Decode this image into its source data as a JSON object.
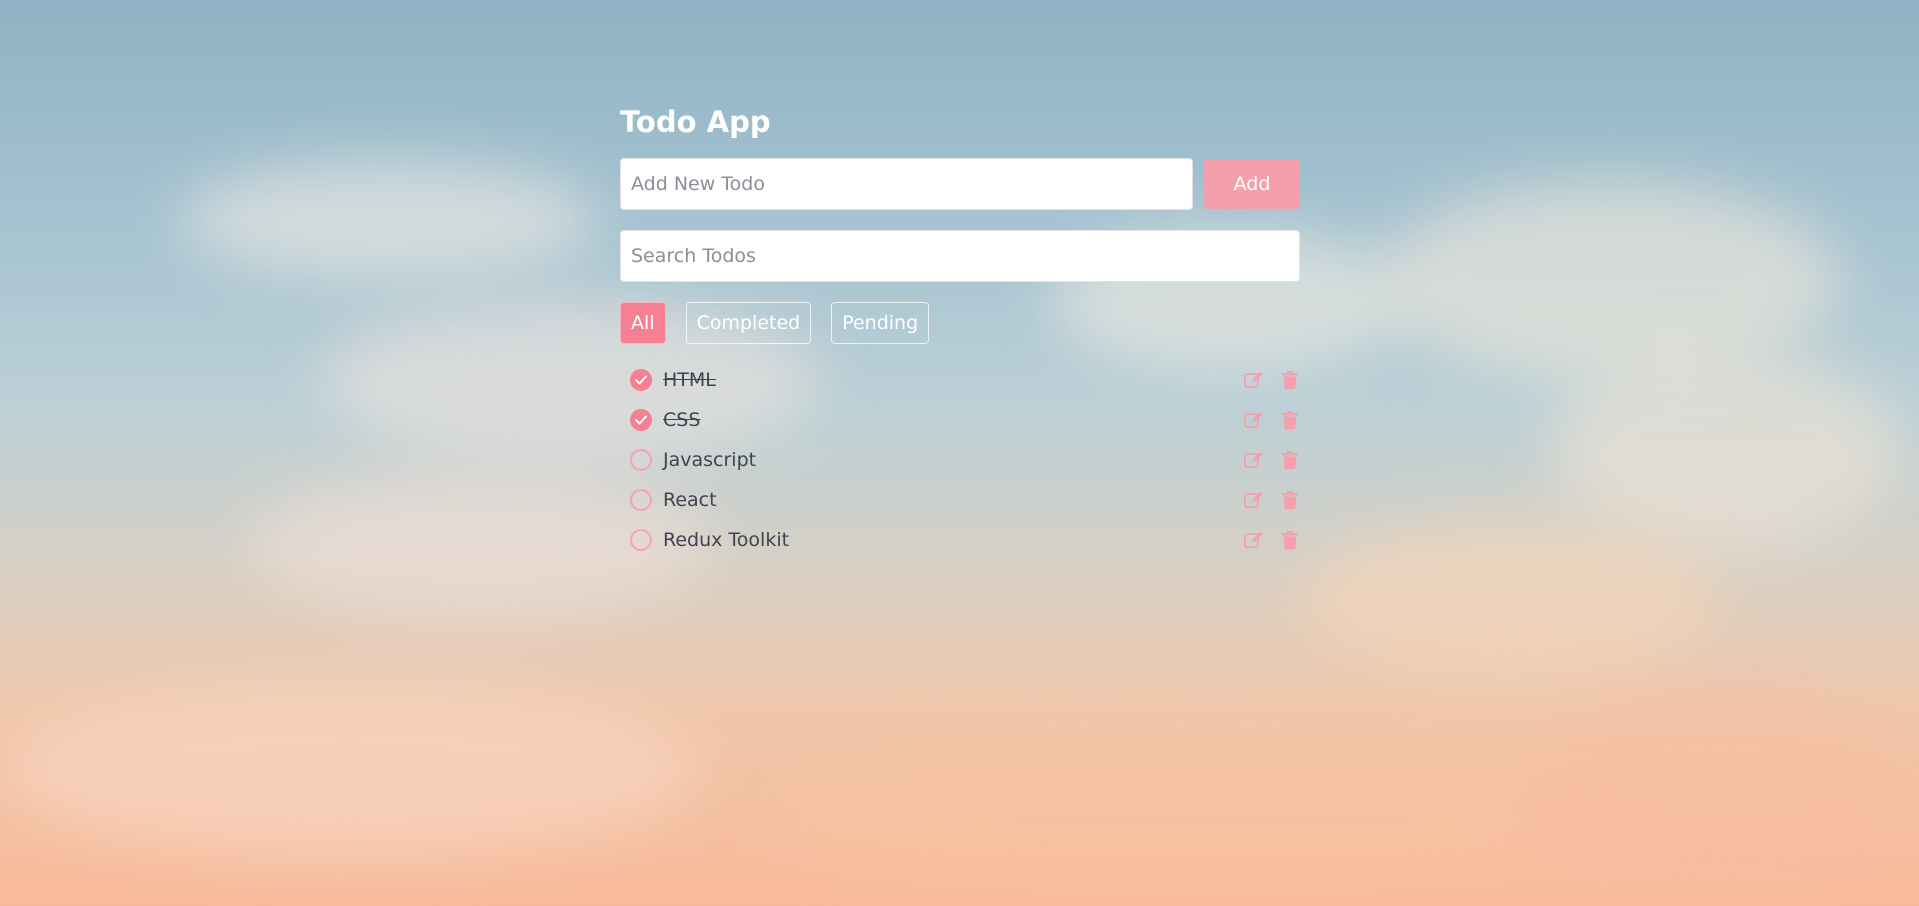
{
  "app": {
    "title": "Todo App",
    "add_placeholder": "Add New Todo",
    "add_label": "Add",
    "search_placeholder": "Search Todos"
  },
  "filters": [
    {
      "label": "All",
      "active": true
    },
    {
      "label": "Completed",
      "active": false
    },
    {
      "label": "Pending",
      "active": false
    }
  ],
  "todos": [
    {
      "text": "HTML",
      "completed": true
    },
    {
      "text": "CSS",
      "completed": true
    },
    {
      "text": "Javascript",
      "completed": false
    },
    {
      "text": "React",
      "completed": false
    },
    {
      "text": "Redux Toolkit",
      "completed": false
    }
  ],
  "icons": {
    "check": "check-icon",
    "edit": "edit-icon",
    "delete": "trash-icon"
  },
  "colors": {
    "accent": "#f57f93",
    "accent_light": "#f3a0aa",
    "text": "#3f4450"
  }
}
